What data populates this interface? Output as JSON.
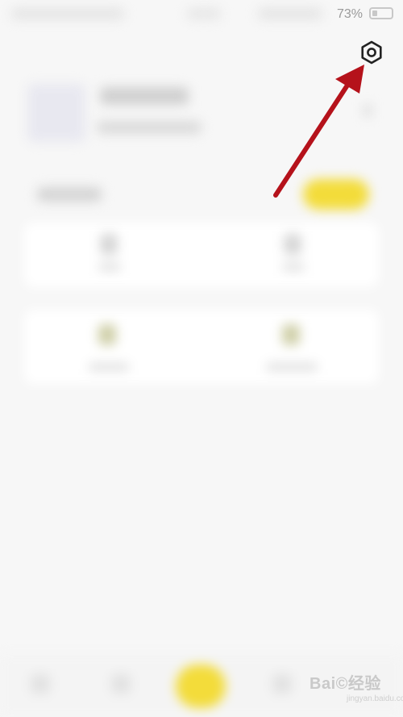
{
  "status_bar": {
    "battery_percent": "73%",
    "battery_level": 0.73
  },
  "header": {
    "settings_icon": "settings-icon"
  },
  "watermark": {
    "text": "Bai©经验",
    "subtext": "jingyan.baidu.com"
  },
  "colors": {
    "accent_yellow": "#f3dc3a",
    "annotation_arrow": "#b5121b",
    "background": "#f7f7f7"
  }
}
